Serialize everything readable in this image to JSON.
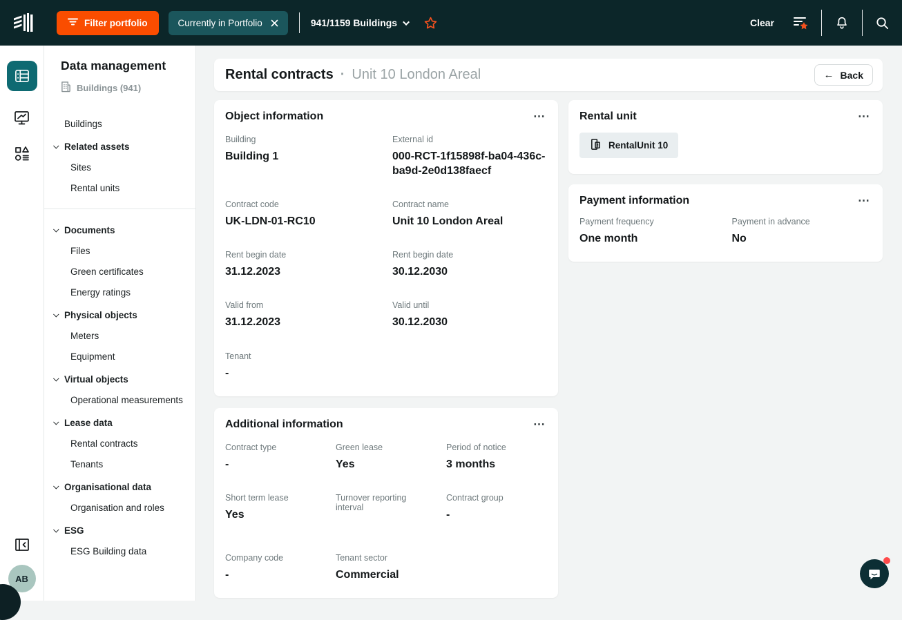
{
  "colors": {
    "topbar_bg": "#0C2629",
    "accent_orange": "#FA4D00",
    "star_orange": "#F4511E",
    "portfolio_chip_teal": "#1B565C",
    "active_rail_teal": "#0E6A72",
    "avatar_bg": "#A9C6BF",
    "page_bg": "#F2F4F4",
    "card_bg": "#FFFFFF"
  },
  "icons": {
    "more": "⋯",
    "back_arrow": "←",
    "close": "✕"
  },
  "topbar": {
    "filter_button_label": "Filter portfolio",
    "portfolio_chip_label": "Currently in Portfolio",
    "buildings_selector_label": "941/1159 Buildings",
    "clear_label": "Clear"
  },
  "sidebar": {
    "title": "Data management",
    "context_label": "Buildings (941)",
    "nav": [
      {
        "label": "Buildings"
      },
      {
        "label": "Related assets"
      },
      {
        "label": "Sites"
      },
      {
        "label": "Rental units"
      },
      {
        "label": "Documents"
      },
      {
        "label": "Files"
      },
      {
        "label": "Green certificates"
      },
      {
        "label": "Energy ratings"
      },
      {
        "label": "Physical objects"
      },
      {
        "label": "Meters"
      },
      {
        "label": "Equipment"
      },
      {
        "label": "Virtual objects"
      },
      {
        "label": "Operational measurements"
      },
      {
        "label": "Lease data"
      },
      {
        "label": "Rental contracts"
      },
      {
        "label": "Tenants"
      },
      {
        "label": "Organisational data"
      },
      {
        "label": "Organisation and roles"
      },
      {
        "label": "ESG"
      },
      {
        "label": "ESG Building data"
      }
    ]
  },
  "page_header": {
    "title": "Rental contracts",
    "dot": "·",
    "subtitle": "Unit 10 London Areal",
    "back_label": "Back"
  },
  "object_information": {
    "title": "Object information",
    "fields": [
      {
        "label": "Building",
        "value": "Building 1"
      },
      {
        "label": "External id",
        "value": "000-RCT-1f15898f-ba04-436c-ba9d-2e0d138faecf"
      },
      {
        "label": "Contract code",
        "value": "UK-LDN-01-RC10"
      },
      {
        "label": "Contract name",
        "value": "Unit 10 London Areal"
      },
      {
        "label": "Rent begin date",
        "value": "31.12.2023"
      },
      {
        "label": "Rent begin date",
        "value": "30.12.2030"
      },
      {
        "label": "Valid from",
        "value": "31.12.2023"
      },
      {
        "label": "Valid until",
        "value": "30.12.2030"
      },
      {
        "label": "Tenant",
        "value": "-"
      }
    ]
  },
  "rental_unit": {
    "title": "Rental unit",
    "chip_label": "RentalUnit 10"
  },
  "payment_information": {
    "title": "Payment information",
    "fields": [
      {
        "label": "Payment frequency",
        "value": "One month"
      },
      {
        "label": "Payment in advance",
        "value": "No"
      }
    ]
  },
  "additional_information": {
    "title": "Additional information",
    "fields": [
      {
        "label": "Contract type",
        "value": "-"
      },
      {
        "label": "Green lease",
        "value": "Yes"
      },
      {
        "label": "Period of notice",
        "value": "3 months"
      },
      {
        "label": "Short term lease",
        "value": "Yes"
      },
      {
        "label": "Turnover reporting interval",
        "value": ""
      },
      {
        "label": "Contract group",
        "value": "-"
      },
      {
        "label": "Company code",
        "value": "-"
      },
      {
        "label": "Tenant sector",
        "value": "Commercial"
      }
    ]
  },
  "avatar": {
    "initials": "AB"
  }
}
